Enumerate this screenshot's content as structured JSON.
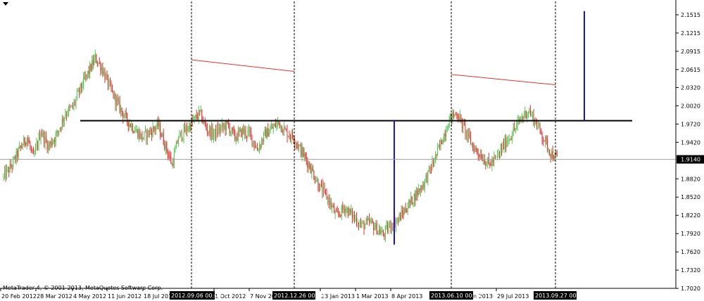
{
  "app": {
    "copyright": "MetaTrader 4, © 2001-2013, MetaQuotes Software Corp.",
    "menu_icon": "triangle-down-icon"
  },
  "chart_data": {
    "type": "candlestick",
    "title": "",
    "xlabel": "",
    "ylabel": "",
    "ylim": [
      1.7021,
      2.1515
    ],
    "y_ticks": [
      "2.1515",
      "2.1215",
      "2.0915",
      "2.0615",
      "2.0320",
      "2.0020",
      "1.9720",
      "1.9420",
      "1.9140",
      "1.8820",
      "1.8520",
      "1.8220",
      "1.7920",
      "1.7620",
      "1.7320",
      "1.7020"
    ],
    "current_price": "1.9140",
    "x_ticks": [
      "20 Feb 2012",
      "28 Mar 2012",
      "4 May 2012",
      "11 Jun 2012",
      "18 Jul 2012",
      "1 Oct 2012",
      "7 Nov 2012",
      "23 Jan 2013",
      "1 Mar 2013",
      "8 Apr 2013",
      "29 Jul 2013"
    ],
    "x_tick_partial": [
      "n 2013"
    ],
    "vertical_markers": [
      {
        "label": "2012.09.06 00:00"
      },
      {
        "label": "2012.12.26 00:00"
      },
      {
        "label": "2013.06.10 00:00"
      },
      {
        "label": "2013.09.27 00:00"
      }
    ],
    "neckline_price": 1.9775,
    "shoulder_trendlines": [
      {
        "from_price": 2.0775,
        "to_price": 2.0585
      },
      {
        "from_price": 2.0535,
        "to_price": 2.0365
      }
    ],
    "target_projections": [
      {
        "bottom": 1.774,
        "top": 1.9775
      },
      {
        "bottom": 1.9775,
        "top": 2.1575
      }
    ],
    "grid": false,
    "colors": {
      "background": "#ffffff",
      "bull_candle": "#50c850",
      "bear_candle": "#dc3232",
      "neckline": "#000000",
      "trendline": "#e83030",
      "projection": "#1414c8",
      "price_line": "#a0a0a0",
      "axis": "#000000"
    },
    "series_path": [
      [
        0,
        1.885
      ],
      [
        8,
        1.905
      ],
      [
        15,
        1.93
      ],
      [
        22,
        1.95
      ],
      [
        28,
        1.915
      ],
      [
        35,
        1.96
      ],
      [
        42,
        1.935
      ],
      [
        50,
        1.955
      ],
      [
        58,
        1.99
      ],
      [
        65,
        2.0
      ],
      [
        72,
        2.03
      ],
      [
        79,
        2.055
      ],
      [
        86,
        2.08
      ],
      [
        92,
        2.065
      ],
      [
        100,
        2.03
      ],
      [
        107,
        2.005
      ],
      [
        115,
        1.98
      ],
      [
        122,
        1.965
      ],
      [
        130,
        1.95
      ],
      [
        138,
        1.96
      ],
      [
        145,
        1.97
      ],
      [
        152,
        1.935
      ],
      [
        158,
        1.905
      ],
      [
        164,
        1.95
      ],
      [
        170,
        1.96
      ],
      [
        177,
        1.975
      ],
      [
        184,
        1.99
      ],
      [
        190,
        1.965
      ],
      [
        197,
        1.955
      ],
      [
        204,
        1.965
      ],
      [
        210,
        1.97
      ],
      [
        217,
        1.95
      ],
      [
        224,
        1.96
      ],
      [
        231,
        1.955
      ],
      [
        238,
        1.93
      ],
      [
        245,
        1.955
      ],
      [
        252,
        1.965
      ],
      [
        258,
        1.975
      ],
      [
        264,
        1.96
      ],
      [
        272,
        1.95
      ],
      [
        280,
        1.925
      ],
      [
        288,
        1.9
      ],
      [
        296,
        1.87
      ],
      [
        304,
        1.85
      ],
      [
        312,
        1.82
      ],
      [
        320,
        1.835
      ],
      [
        328,
        1.82
      ],
      [
        336,
        1.805
      ],
      [
        344,
        1.81
      ],
      [
        350,
        1.8
      ],
      [
        356,
        1.79
      ],
      [
        362,
        1.805
      ],
      [
        370,
        1.815
      ],
      [
        378,
        1.835
      ],
      [
        386,
        1.855
      ],
      [
        394,
        1.875
      ],
      [
        402,
        1.905
      ],
      [
        410,
        1.94
      ],
      [
        418,
        1.98
      ],
      [
        425,
        1.99
      ],
      [
        432,
        1.965
      ],
      [
        440,
        1.935
      ],
      [
        448,
        1.92
      ],
      [
        455,
        1.905
      ],
      [
        462,
        1.915
      ],
      [
        470,
        1.94
      ],
      [
        478,
        1.96
      ],
      [
        485,
        1.98
      ],
      [
        492,
        1.995
      ],
      [
        499,
        1.975
      ],
      [
        506,
        1.95
      ],
      [
        513,
        1.925
      ],
      [
        519,
        1.914
      ]
    ]
  }
}
